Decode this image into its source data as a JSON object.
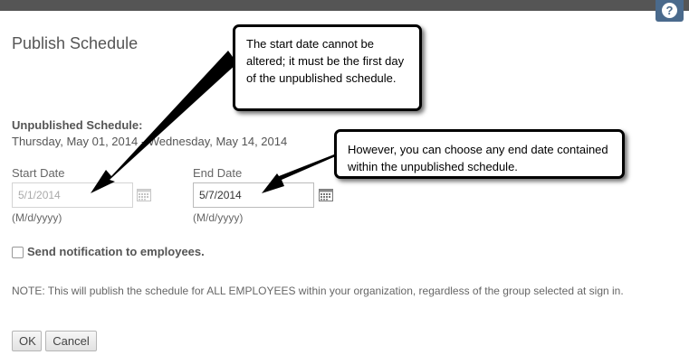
{
  "dialog": {
    "title": "Publish Schedule",
    "help_icon": "question-icon",
    "help_glyph": "?",
    "unpublished_label": "Unpublished Schedule:",
    "unpublished_range": "Thursday, May 01, 2014 - Wednesday, May 14, 2014",
    "start_date": {
      "label": "Start Date",
      "value": "5/1/2014",
      "format": "(M/d/yyyy)",
      "disabled": true,
      "icon": "calendar-icon"
    },
    "end_date": {
      "label": "End Date",
      "value": "5/7/2014",
      "format": "(M/d/yyyy)",
      "icon": "calendar-icon"
    },
    "notify_checkbox": {
      "label": "Send notification to employees.",
      "checked": false
    },
    "note": "NOTE: This will publish the schedule for ALL EMPLOYEES within your organization, regardless of the group selected at sign in.",
    "ok_label": "OK",
    "cancel_label": "Cancel"
  },
  "annotations": {
    "callout_1": "The start date cannot be altered; it must be the first day of the unpublished schedule.",
    "callout_2": "However, you can choose any end date contained within the unpublished schedule."
  },
  "colors": {
    "top_bar": "#555555",
    "help_button": "#4a6a8c",
    "text": "#555555"
  }
}
